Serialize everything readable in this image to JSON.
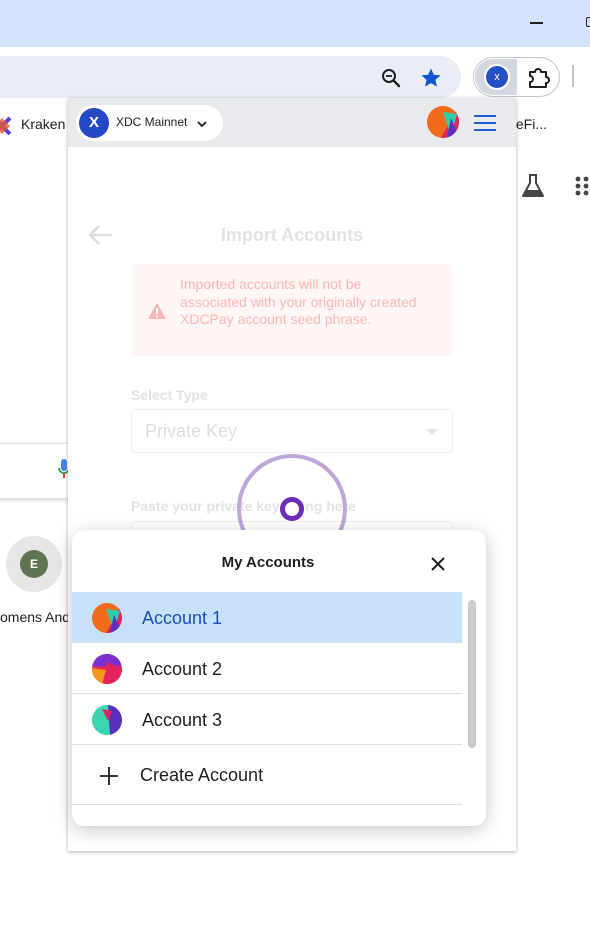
{
  "browser": {
    "bookmarks": [
      {
        "label": "Kraken"
      },
      {
        "label": "teFi..."
      }
    ],
    "shortcut": {
      "avatar_letter": "E",
      "label": "omens And"
    }
  },
  "popup": {
    "network": {
      "logo_letter": "X",
      "label": "XDC Mainnet"
    },
    "page_title": "Import Accounts",
    "warning": "Imported accounts will not be associated with your originally created XDCPay account seed phrase.",
    "select_type_label": "Select Type",
    "select_type_value": "Private Key",
    "paste_label": "Paste your private key string here"
  },
  "accounts_modal": {
    "title": "My Accounts",
    "accounts": [
      {
        "name": "Account 1",
        "selected": true
      },
      {
        "name": "Account 2",
        "selected": false
      },
      {
        "name": "Account 3",
        "selected": false
      }
    ],
    "create_label": "Create Account"
  },
  "colors": {
    "xdc_blue": "#2449c5",
    "selected_row": "#c6e1f8",
    "spinner_purple": "#6d2db9"
  }
}
